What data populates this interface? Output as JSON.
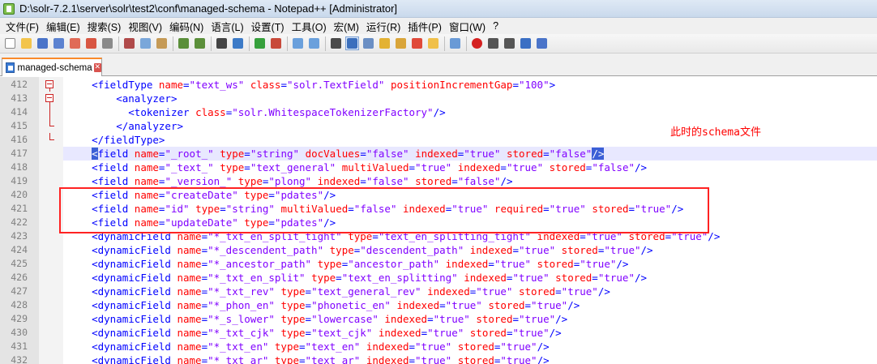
{
  "window": {
    "title": "D:\\solr-7.2.1\\server\\solr\\test2\\conf\\managed-schema - Notepad++ [Administrator]"
  },
  "menu": [
    "文件(F)",
    "编辑(E)",
    "搜索(S)",
    "视图(V)",
    "编码(N)",
    "语言(L)",
    "设置(T)",
    "工具(O)",
    "宏(M)",
    "运行(R)",
    "插件(P)",
    "窗口(W)",
    "?"
  ],
  "tab": {
    "label": "managed-schema",
    "close": "✕"
  },
  "annotation": "此时的schema文件",
  "lines": [
    {
      "n": "412",
      "fold": "open",
      "segs": [
        [
          "",
          "    "
        ],
        [
          "t",
          "<fieldType "
        ],
        [
          "a",
          "name"
        ],
        [
          "t",
          "="
        ],
        [
          "v",
          "\"text_ws\""
        ],
        [
          "t",
          " "
        ],
        [
          "a",
          "class"
        ],
        [
          "t",
          "="
        ],
        [
          "v",
          "\"solr.TextField\""
        ],
        [
          "t",
          " "
        ],
        [
          "a",
          "positionIncrementGap"
        ],
        [
          "t",
          "="
        ],
        [
          "v",
          "\"100\""
        ],
        [
          "t",
          ">"
        ]
      ]
    },
    {
      "n": "413",
      "fold": "open",
      "segs": [
        [
          "",
          "        "
        ],
        [
          "t",
          "<analyzer>"
        ]
      ]
    },
    {
      "n": "414",
      "fold": "line",
      "segs": [
        [
          "",
          "          "
        ],
        [
          "t",
          "<tokenizer "
        ],
        [
          "a",
          "class"
        ],
        [
          "t",
          "="
        ],
        [
          "v",
          "\"solr.WhitespaceTokenizerFactory\""
        ],
        [
          "t",
          "/>"
        ]
      ]
    },
    {
      "n": "415",
      "fold": "end",
      "segs": [
        [
          "",
          "        "
        ],
        [
          "t",
          "</analyzer>"
        ]
      ]
    },
    {
      "n": "416",
      "fold": "end",
      "segs": [
        [
          "",
          "    "
        ],
        [
          "t",
          "</fieldType>"
        ]
      ]
    },
    {
      "n": "417",
      "fold": "",
      "hl": true,
      "segs": [
        [
          "",
          "    "
        ],
        [
          "bh",
          "<"
        ],
        [
          "t",
          "field "
        ],
        [
          "a",
          "name"
        ],
        [
          "t",
          "="
        ],
        [
          "v",
          "\"_root_\""
        ],
        [
          "t",
          " "
        ],
        [
          "a",
          "type"
        ],
        [
          "t",
          "="
        ],
        [
          "v",
          "\"string\""
        ],
        [
          "t",
          " "
        ],
        [
          "a",
          "docValues"
        ],
        [
          "t",
          "="
        ],
        [
          "v",
          "\"false\""
        ],
        [
          "t",
          " "
        ],
        [
          "a",
          "indexed"
        ],
        [
          "t",
          "="
        ],
        [
          "v",
          "\"true\""
        ],
        [
          "t",
          " "
        ],
        [
          "a",
          "stored"
        ],
        [
          "t",
          "="
        ],
        [
          "v",
          "\"false\""
        ],
        [
          "bh",
          "/>"
        ]
      ]
    },
    {
      "n": "418",
      "fold": "",
      "segs": [
        [
          "",
          "    "
        ],
        [
          "t",
          "<field "
        ],
        [
          "a",
          "name"
        ],
        [
          "t",
          "="
        ],
        [
          "v",
          "\"_text_\""
        ],
        [
          "t",
          " "
        ],
        [
          "a",
          "type"
        ],
        [
          "t",
          "="
        ],
        [
          "v",
          "\"text_general\""
        ],
        [
          "t",
          " "
        ],
        [
          "a",
          "multiValued"
        ],
        [
          "t",
          "="
        ],
        [
          "v",
          "\"true\""
        ],
        [
          "t",
          " "
        ],
        [
          "a",
          "indexed"
        ],
        [
          "t",
          "="
        ],
        [
          "v",
          "\"true\""
        ],
        [
          "t",
          " "
        ],
        [
          "a",
          "stored"
        ],
        [
          "t",
          "="
        ],
        [
          "v",
          "\"false\""
        ],
        [
          "t",
          "/>"
        ]
      ]
    },
    {
      "n": "419",
      "fold": "",
      "segs": [
        [
          "",
          "    "
        ],
        [
          "t",
          "<field "
        ],
        [
          "a",
          "name"
        ],
        [
          "t",
          "="
        ],
        [
          "v",
          "\"_version_\""
        ],
        [
          "t",
          " "
        ],
        [
          "a",
          "type"
        ],
        [
          "t",
          "="
        ],
        [
          "v",
          "\"plong\""
        ],
        [
          "t",
          " "
        ],
        [
          "a",
          "indexed"
        ],
        [
          "t",
          "="
        ],
        [
          "v",
          "\"false\""
        ],
        [
          "t",
          " "
        ],
        [
          "a",
          "stored"
        ],
        [
          "t",
          "="
        ],
        [
          "v",
          "\"false\""
        ],
        [
          "t",
          "/>"
        ]
      ]
    },
    {
      "n": "420",
      "fold": "",
      "segs": [
        [
          "",
          "    "
        ],
        [
          "t",
          "<field "
        ],
        [
          "a",
          "name"
        ],
        [
          "t",
          "="
        ],
        [
          "v",
          "\"createDate\""
        ],
        [
          "t",
          " "
        ],
        [
          "a",
          "type"
        ],
        [
          "t",
          "="
        ],
        [
          "v",
          "\"pdates\""
        ],
        [
          "t",
          "/>"
        ]
      ]
    },
    {
      "n": "421",
      "fold": "",
      "segs": [
        [
          "",
          "    "
        ],
        [
          "t",
          "<field "
        ],
        [
          "a",
          "name"
        ],
        [
          "t",
          "="
        ],
        [
          "v",
          "\"id\""
        ],
        [
          "t",
          " "
        ],
        [
          "a",
          "type"
        ],
        [
          "t",
          "="
        ],
        [
          "v",
          "\"string\""
        ],
        [
          "t",
          " "
        ],
        [
          "a",
          "multiValued"
        ],
        [
          "t",
          "="
        ],
        [
          "v",
          "\"false\""
        ],
        [
          "t",
          " "
        ],
        [
          "a",
          "indexed"
        ],
        [
          "t",
          "="
        ],
        [
          "v",
          "\"true\""
        ],
        [
          "t",
          " "
        ],
        [
          "a",
          "required"
        ],
        [
          "t",
          "="
        ],
        [
          "v",
          "\"true\""
        ],
        [
          "t",
          " "
        ],
        [
          "a",
          "stored"
        ],
        [
          "t",
          "="
        ],
        [
          "v",
          "\"true\""
        ],
        [
          "t",
          "/>"
        ]
      ]
    },
    {
      "n": "422",
      "fold": "",
      "segs": [
        [
          "",
          "    "
        ],
        [
          "t",
          "<field "
        ],
        [
          "a",
          "name"
        ],
        [
          "t",
          "="
        ],
        [
          "v",
          "\"updateDate\""
        ],
        [
          "t",
          " "
        ],
        [
          "a",
          "type"
        ],
        [
          "t",
          "="
        ],
        [
          "v",
          "\"pdates\""
        ],
        [
          "t",
          "/>"
        ]
      ]
    },
    {
      "n": "423",
      "fold": "",
      "segs": [
        [
          "",
          "    "
        ],
        [
          "t",
          "<dynamicField "
        ],
        [
          "a",
          "name"
        ],
        [
          "t",
          "="
        ],
        [
          "v",
          "\"*_txt_en_split_tight\""
        ],
        [
          "t",
          " "
        ],
        [
          "a",
          "type"
        ],
        [
          "t",
          "="
        ],
        [
          "v",
          "\"text_en_splitting_tight\""
        ],
        [
          "t",
          " "
        ],
        [
          "a",
          "indexed"
        ],
        [
          "t",
          "="
        ],
        [
          "v",
          "\"true\""
        ],
        [
          "t",
          " "
        ],
        [
          "a",
          "stored"
        ],
        [
          "t",
          "="
        ],
        [
          "v",
          "\"true\""
        ],
        [
          "t",
          "/>"
        ]
      ]
    },
    {
      "n": "424",
      "fold": "",
      "segs": [
        [
          "",
          "    "
        ],
        [
          "t",
          "<dynamicField "
        ],
        [
          "a",
          "name"
        ],
        [
          "t",
          "="
        ],
        [
          "v",
          "\"*_descendent_path\""
        ],
        [
          "t",
          " "
        ],
        [
          "a",
          "type"
        ],
        [
          "t",
          "="
        ],
        [
          "v",
          "\"descendent_path\""
        ],
        [
          "t",
          " "
        ],
        [
          "a",
          "indexed"
        ],
        [
          "t",
          "="
        ],
        [
          "v",
          "\"true\""
        ],
        [
          "t",
          " "
        ],
        [
          "a",
          "stored"
        ],
        [
          "t",
          "="
        ],
        [
          "v",
          "\"true\""
        ],
        [
          "t",
          "/>"
        ]
      ]
    },
    {
      "n": "425",
      "fold": "",
      "segs": [
        [
          "",
          "    "
        ],
        [
          "t",
          "<dynamicField "
        ],
        [
          "a",
          "name"
        ],
        [
          "t",
          "="
        ],
        [
          "v",
          "\"*_ancestor_path\""
        ],
        [
          "t",
          " "
        ],
        [
          "a",
          "type"
        ],
        [
          "t",
          "="
        ],
        [
          "v",
          "\"ancestor_path\""
        ],
        [
          "t",
          " "
        ],
        [
          "a",
          "indexed"
        ],
        [
          "t",
          "="
        ],
        [
          "v",
          "\"true\""
        ],
        [
          "t",
          " "
        ],
        [
          "a",
          "stored"
        ],
        [
          "t",
          "="
        ],
        [
          "v",
          "\"true\""
        ],
        [
          "t",
          "/>"
        ]
      ]
    },
    {
      "n": "426",
      "fold": "",
      "segs": [
        [
          "",
          "    "
        ],
        [
          "t",
          "<dynamicField "
        ],
        [
          "a",
          "name"
        ],
        [
          "t",
          "="
        ],
        [
          "v",
          "\"*_txt_en_split\""
        ],
        [
          "t",
          " "
        ],
        [
          "a",
          "type"
        ],
        [
          "t",
          "="
        ],
        [
          "v",
          "\"text_en_splitting\""
        ],
        [
          "t",
          " "
        ],
        [
          "a",
          "indexed"
        ],
        [
          "t",
          "="
        ],
        [
          "v",
          "\"true\""
        ],
        [
          "t",
          " "
        ],
        [
          "a",
          "stored"
        ],
        [
          "t",
          "="
        ],
        [
          "v",
          "\"true\""
        ],
        [
          "t",
          "/>"
        ]
      ]
    },
    {
      "n": "427",
      "fold": "",
      "segs": [
        [
          "",
          "    "
        ],
        [
          "t",
          "<dynamicField "
        ],
        [
          "a",
          "name"
        ],
        [
          "t",
          "="
        ],
        [
          "v",
          "\"*_txt_rev\""
        ],
        [
          "t",
          " "
        ],
        [
          "a",
          "type"
        ],
        [
          "t",
          "="
        ],
        [
          "v",
          "\"text_general_rev\""
        ],
        [
          "t",
          " "
        ],
        [
          "a",
          "indexed"
        ],
        [
          "t",
          "="
        ],
        [
          "v",
          "\"true\""
        ],
        [
          "t",
          " "
        ],
        [
          "a",
          "stored"
        ],
        [
          "t",
          "="
        ],
        [
          "v",
          "\"true\""
        ],
        [
          "t",
          "/>"
        ]
      ]
    },
    {
      "n": "428",
      "fold": "",
      "segs": [
        [
          "",
          "    "
        ],
        [
          "t",
          "<dynamicField "
        ],
        [
          "a",
          "name"
        ],
        [
          "t",
          "="
        ],
        [
          "v",
          "\"*_phon_en\""
        ],
        [
          "t",
          " "
        ],
        [
          "a",
          "type"
        ],
        [
          "t",
          "="
        ],
        [
          "v",
          "\"phonetic_en\""
        ],
        [
          "t",
          " "
        ],
        [
          "a",
          "indexed"
        ],
        [
          "t",
          "="
        ],
        [
          "v",
          "\"true\""
        ],
        [
          "t",
          " "
        ],
        [
          "a",
          "stored"
        ],
        [
          "t",
          "="
        ],
        [
          "v",
          "\"true\""
        ],
        [
          "t",
          "/>"
        ]
      ]
    },
    {
      "n": "429",
      "fold": "",
      "segs": [
        [
          "",
          "    "
        ],
        [
          "t",
          "<dynamicField "
        ],
        [
          "a",
          "name"
        ],
        [
          "t",
          "="
        ],
        [
          "v",
          "\"*_s_lower\""
        ],
        [
          "t",
          " "
        ],
        [
          "a",
          "type"
        ],
        [
          "t",
          "="
        ],
        [
          "v",
          "\"lowercase\""
        ],
        [
          "t",
          " "
        ],
        [
          "a",
          "indexed"
        ],
        [
          "t",
          "="
        ],
        [
          "v",
          "\"true\""
        ],
        [
          "t",
          " "
        ],
        [
          "a",
          "stored"
        ],
        [
          "t",
          "="
        ],
        [
          "v",
          "\"true\""
        ],
        [
          "t",
          "/>"
        ]
      ]
    },
    {
      "n": "430",
      "fold": "",
      "segs": [
        [
          "",
          "    "
        ],
        [
          "t",
          "<dynamicField "
        ],
        [
          "a",
          "name"
        ],
        [
          "t",
          "="
        ],
        [
          "v",
          "\"*_txt_cjk\""
        ],
        [
          "t",
          " "
        ],
        [
          "a",
          "type"
        ],
        [
          "t",
          "="
        ],
        [
          "v",
          "\"text_cjk\""
        ],
        [
          "t",
          " "
        ],
        [
          "a",
          "indexed"
        ],
        [
          "t",
          "="
        ],
        [
          "v",
          "\"true\""
        ],
        [
          "t",
          " "
        ],
        [
          "a",
          "stored"
        ],
        [
          "t",
          "="
        ],
        [
          "v",
          "\"true\""
        ],
        [
          "t",
          "/>"
        ]
      ]
    },
    {
      "n": "431",
      "fold": "",
      "segs": [
        [
          "",
          "    "
        ],
        [
          "t",
          "<dynamicField "
        ],
        [
          "a",
          "name"
        ],
        [
          "t",
          "="
        ],
        [
          "v",
          "\"*_txt_en\""
        ],
        [
          "t",
          " "
        ],
        [
          "a",
          "type"
        ],
        [
          "t",
          "="
        ],
        [
          "v",
          "\"text_en\""
        ],
        [
          "t",
          " "
        ],
        [
          "a",
          "indexed"
        ],
        [
          "t",
          "="
        ],
        [
          "v",
          "\"true\""
        ],
        [
          "t",
          " "
        ],
        [
          "a",
          "stored"
        ],
        [
          "t",
          "="
        ],
        [
          "v",
          "\"true\""
        ],
        [
          "t",
          "/>"
        ]
      ]
    },
    {
      "n": "432",
      "fold": "",
      "segs": [
        [
          "",
          "    "
        ],
        [
          "t",
          "<dynamicField "
        ],
        [
          "a",
          "name"
        ],
        [
          "t",
          "="
        ],
        [
          "v",
          "\"*_txt_ar\""
        ],
        [
          "t",
          " "
        ],
        [
          "a",
          "type"
        ],
        [
          "t",
          "="
        ],
        [
          "v",
          "\"text_ar\""
        ],
        [
          "t",
          " "
        ],
        [
          "a",
          "indexed"
        ],
        [
          "t",
          "="
        ],
        [
          "v",
          "\"true\""
        ],
        [
          "t",
          " "
        ],
        [
          "a",
          "stored"
        ],
        [
          "t",
          "="
        ],
        [
          "v",
          "\"true\""
        ],
        [
          "t",
          "/>"
        ]
      ]
    }
  ],
  "toolbar_icons": [
    "new-file-icon",
    "open-file-icon",
    "save-icon",
    "save-all-icon",
    "close-icon",
    "close-all-icon",
    "print-icon",
    "cut-icon",
    "copy-icon",
    "paste-icon",
    "undo-icon",
    "redo-icon",
    "find-icon",
    "replace-icon",
    "zoom-in-icon",
    "zoom-out-icon",
    "sync-vertical-icon",
    "sync-horizontal-icon",
    "word-wrap-icon",
    "show-all-chars-icon",
    "indent-guide-icon",
    "udl-icon",
    "doc-map-icon",
    "function-list-icon",
    "folder-workspace-icon",
    "monitor-icon",
    "record-macro-icon",
    "stop-record-icon",
    "playback-icon",
    "run-multiple-icon",
    "save-macro-icon"
  ],
  "colors": {
    "tag": "#0000ff",
    "attr": "#ff0000",
    "value": "#8000ff",
    "annotation": "#ff0000",
    "highlight": "#e8e8ff"
  }
}
